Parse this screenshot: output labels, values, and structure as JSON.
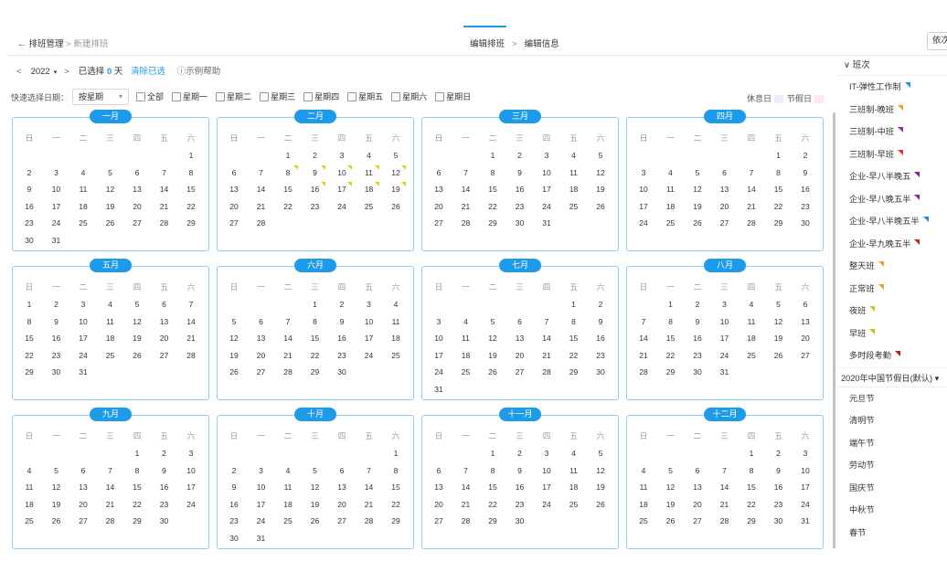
{
  "header": {
    "back_arrow": "←",
    "back_label": "排班管理",
    "back_sub": "新建排班",
    "steps": [
      "编辑排班",
      "编辑信息"
    ],
    "step_sep": ">",
    "close_label": "依次"
  },
  "yearbar": {
    "prev": "<",
    "year": "2022",
    "next": ">",
    "selected_prefix": "已选择",
    "selected_count": "0",
    "selected_unit": "天",
    "clear": "清除已选",
    "help": "示例帮助"
  },
  "quick": {
    "label": "快速选择日期：",
    "select_value": "按星期",
    "checkboxes": [
      "全部",
      "星期一",
      "星期二",
      "星期三",
      "星期四",
      "星期五",
      "星期六",
      "星期日"
    ]
  },
  "legend": {
    "rest_label": "休息日",
    "rest_color": "#e8eef8",
    "holiday_label": "节假日",
    "holiday_color": "#fde8ea"
  },
  "weekdays": [
    "日",
    "一",
    "二",
    "三",
    "四",
    "五",
    "六"
  ],
  "months": [
    {
      "name": "一月",
      "start": 6,
      "days": 31
    },
    {
      "name": "二月",
      "start": 2,
      "days": 28
    },
    {
      "name": "三月",
      "start": 2,
      "days": 31
    },
    {
      "name": "四月",
      "start": 5,
      "days": 30
    },
    {
      "name": "五月",
      "start": 0,
      "days": 31
    },
    {
      "name": "六月",
      "start": 3,
      "days": 30
    },
    {
      "name": "七月",
      "start": 5,
      "days": 31
    },
    {
      "name": "八月",
      "start": 1,
      "days": 31
    },
    {
      "name": "九月",
      "start": 4,
      "days": 30
    },
    {
      "name": "十月",
      "start": 6,
      "days": 31
    },
    {
      "name": "十一月",
      "start": 2,
      "days": 30
    },
    {
      "name": "十二月",
      "start": 4,
      "days": 31
    }
  ],
  "marked_days": {
    "month": 1,
    "days": [
      8,
      9,
      10,
      11,
      12,
      16,
      17,
      18,
      19
    ]
  },
  "panel": {
    "shift_header": "班次",
    "shifts": [
      {
        "label": "IT-弹性工作制",
        "color": "#1e9be8"
      },
      {
        "label": "三班制-晚班",
        "color": "#f0a020"
      },
      {
        "label": "三班制-中班",
        "color": "#9c27b0"
      },
      {
        "label": "三班制-早班",
        "color": "#e53935"
      },
      {
        "label": "企业-早八半晚五",
        "color": "#7b1fa2"
      },
      {
        "label": "企业-早八晚五半",
        "color": "#8e24aa"
      },
      {
        "label": "企业-早八半晚五半",
        "color": "#1e88e5"
      },
      {
        "label": "企业-早九晚五半",
        "color": "#c62828"
      },
      {
        "label": "整天班",
        "color": "#f0a020"
      },
      {
        "label": "正常班",
        "color": "#f0a020"
      },
      {
        "label": "夜班",
        "color": "#d4c21a"
      },
      {
        "label": "早班",
        "color": "#d4c21a"
      },
      {
        "label": "多时段考勤",
        "color": "#b71c1c"
      }
    ],
    "holiday_header": "2020年中国节假日(默认) ▾",
    "holidays": [
      "元旦节",
      "清明节",
      "端午节",
      "劳动节",
      "国庆节",
      "中秋节",
      "春节"
    ]
  }
}
